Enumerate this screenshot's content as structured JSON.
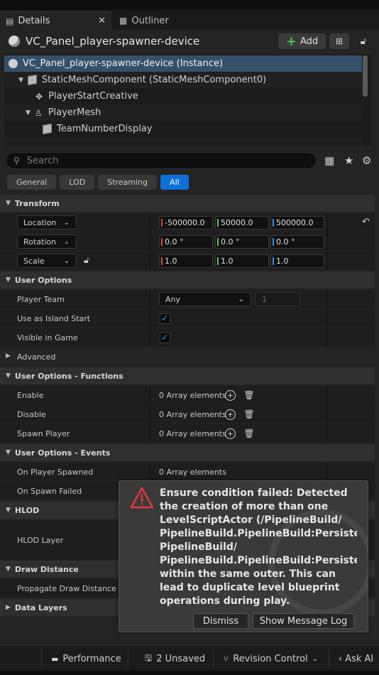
{
  "tabs": [
    {
      "label": "Details",
      "icon": "details-icon",
      "active": true
    },
    {
      "label": "Outliner",
      "icon": "outliner-icon",
      "active": false
    }
  ],
  "actor": {
    "name": "VC_Panel_player-spawner-device",
    "add_label": "Add"
  },
  "tree": [
    {
      "label": "VC_Panel_player-spawner-device (Instance)",
      "icon": "actor-icon",
      "selected": true
    },
    {
      "label": "StaticMeshComponent (StaticMeshComponent0)",
      "icon": "static-mesh-icon"
    },
    {
      "label": "PlayerStartCreative",
      "icon": "player-start-icon"
    },
    {
      "label": "PlayerMesh",
      "icon": "skeletal-mesh-icon"
    },
    {
      "label": "TeamNumberDisplay",
      "icon": "static-mesh-icon"
    }
  ],
  "search": {
    "placeholder": "Search"
  },
  "filters": [
    "General",
    "LOD",
    "Streaming",
    "All"
  ],
  "active_filter": "All",
  "transform": {
    "header": "Transform",
    "location": {
      "label": "Location",
      "x": "-500000.0",
      "y": "50000.0",
      "z": "500000.0"
    },
    "rotation": {
      "label": "Rotation",
      "x": "0.0 °",
      "y": "0.0 °",
      "z": "0.0 °"
    },
    "scale": {
      "label": "Scale",
      "x": "1.0",
      "y": "1.0",
      "z": "1.0"
    }
  },
  "user_options": {
    "header": "User Options",
    "player_team": {
      "label": "Player Team",
      "value": "Any",
      "number": "1"
    },
    "island_start": {
      "label": "Use as Island Start"
    },
    "visible": {
      "label": "Visible in Game"
    },
    "advanced": "Advanced"
  },
  "functions": {
    "header": "User Options - Functions",
    "rows": [
      {
        "label": "Enable",
        "value": "0 Array elements"
      },
      {
        "label": "Disable",
        "value": "0 Array elements"
      },
      {
        "label": "Spawn Player",
        "value": "0 Array elements"
      }
    ]
  },
  "events": {
    "header": "User Options - Events",
    "rows": [
      {
        "label": "On Player Spawned",
        "value": "0 Array elements"
      },
      {
        "label": "On Spawn Failed"
      }
    ]
  },
  "hlod": {
    "header": "HLOD",
    "layer_label": "HLOD Layer"
  },
  "draw_distance": {
    "header": "Draw Distance",
    "propagate_label": "Propagate Draw Distance on"
  },
  "data_layers": {
    "header": "Data Layers"
  },
  "toast": {
    "message": "Ensure condition failed: Detected the creation of more than one LevelScriptActor (/PipelineBuild/ PipelineBuild.PipelineBuild:PersistentL PipelineBuild/ PipelineBuild.PipelineBuild:PersistentL within the same outer. This can lead to duplicate level blueprint operations during play.",
    "dismiss": "Dismiss",
    "show_log": "Show Message Log"
  },
  "statusbar": {
    "performance": "Performance",
    "unsaved": "2 Unsaved",
    "revision": "Revision Control",
    "ask_ai": "Ask AI"
  },
  "colors": {
    "accent": "#0e70d8",
    "selection": "#36506b",
    "axis_x": "#e0463b",
    "axis_y": "#4fc64f",
    "axis_z": "#2d8ff0"
  }
}
